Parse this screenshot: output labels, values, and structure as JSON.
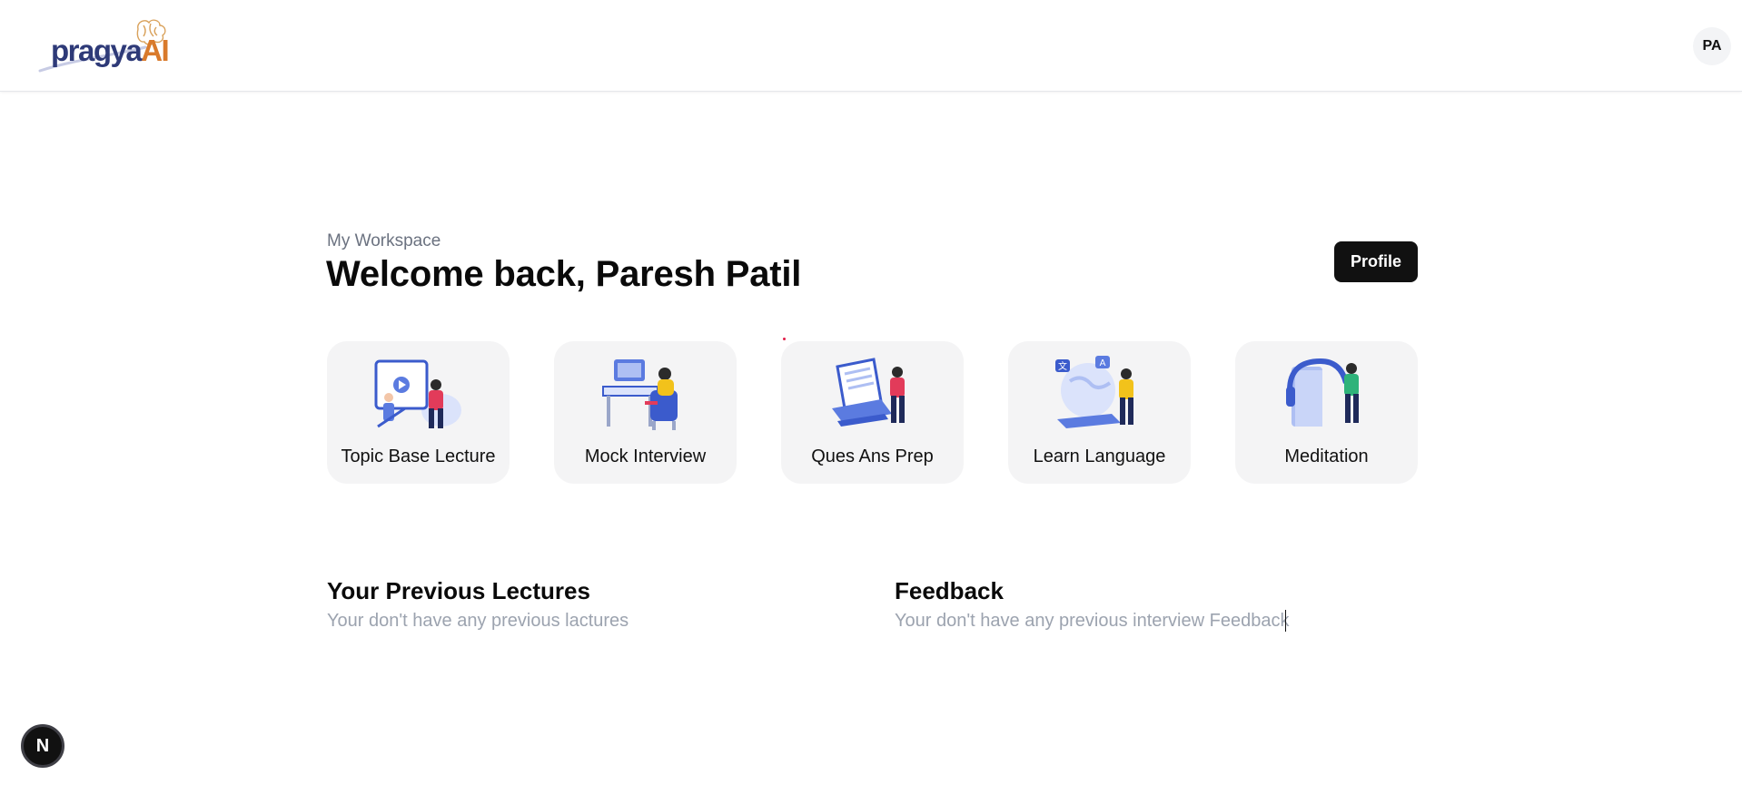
{
  "header": {
    "logo": {
      "text_main": "pragya",
      "text_accent": "AI"
    },
    "avatar_initials": "PA"
  },
  "workspace": {
    "label": "My Workspace",
    "welcome": "Welcome back, Paresh Patil",
    "profile_button": "Profile"
  },
  "features": [
    {
      "label": "Topic Base Lecture",
      "icon": "lecture-illustration-icon"
    },
    {
      "label": "Mock Interview",
      "icon": "interview-illustration-icon"
    },
    {
      "label": "Ques Ans Prep",
      "icon": "qa-prep-illustration-icon"
    },
    {
      "label": "Learn Language",
      "icon": "language-illustration-icon"
    },
    {
      "label": "Meditation",
      "icon": "meditation-illustration-icon"
    }
  ],
  "previous_lectures": {
    "title": "Your Previous Lectures",
    "empty": "Your don't have any previous lactures"
  },
  "feedback": {
    "title": "Feedback",
    "empty": "Your don't have any previous interview Feedback"
  },
  "dev_badge": "N",
  "colors": {
    "brand_primary": "#2e3a78",
    "brand_accent": "#d97a2b",
    "card_bg": "#f4f4f5",
    "button_bg": "#111111",
    "illustration_blue": "#5b7be0"
  }
}
